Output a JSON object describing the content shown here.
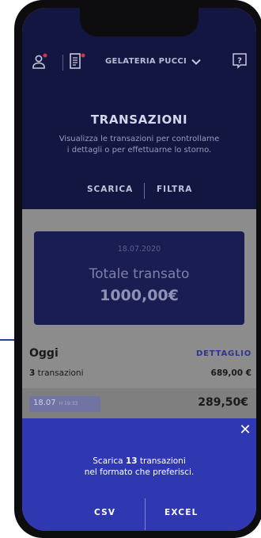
{
  "header": {
    "store_name": "GELATERIA PUCCI",
    "title": "TRANSAZIONI",
    "subtitle_line1": "Visualizza le transazioni per controllarne",
    "subtitle_line2": "i dettagli o per effettuarne lo storno.",
    "action_download": "SCARICA",
    "action_filter": "FILTRA",
    "icons": [
      "user-icon",
      "receipt-icon",
      "chevron-down-icon",
      "help-icon"
    ],
    "notification_color": "#e0304a"
  },
  "summary": {
    "date": "18.07.2020",
    "label": "Totale transato",
    "total": "1000,00€"
  },
  "section": {
    "title": "Oggi",
    "detail_link": "DETTAGLIO",
    "count_number": "3",
    "count_label": "transazioni",
    "amount": "689,00 €"
  },
  "transaction_row": {
    "date": "18.07",
    "time": "H 19:33",
    "amount": "289,50€"
  },
  "download_sheet": {
    "line1_prefix": "Scarica",
    "line1_count": "13",
    "line1_suffix": "transazioni",
    "line2": "nel formato che preferisci.",
    "option_csv": "CSV",
    "option_excel": "EXCEL",
    "close_icon": "close-icon",
    "accent_color": "#2f38b0"
  }
}
